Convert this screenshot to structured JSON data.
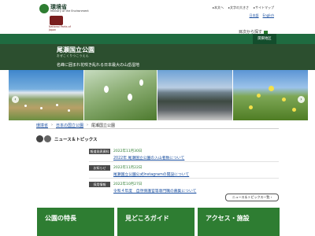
{
  "header": {
    "logo_ministry_ja": "環境省",
    "logo_ministry_en": "Ministry of the Environment",
    "logo_parks_text": "National Parks of Japan",
    "links": [
      "▸本文へ",
      "▸文字の大きさ",
      "▸サイトマップ"
    ],
    "languages": [
      "日本語",
      "English"
    ],
    "toc_button": "目次から探す",
    "band_tab": "関東地区"
  },
  "park": {
    "name": "尾瀬国立公園",
    "kana": "おぜこくりつこうえん",
    "tagline": "名峰に囲まれ花咲き乱れる日本最大の山岳湿地"
  },
  "hero": {
    "prev": "‹",
    "next": "›"
  },
  "breadcrumb": [
    "環境省",
    "日本の国立公園",
    "尾瀬国立公園"
  ],
  "news": {
    "title": "ニュース＆トピックス",
    "items": [
      {
        "tag": "報道発表資料",
        "date": "2022年11月30日",
        "text": "2022年 尾瀬国立公園の入山者数について"
      },
      {
        "tag": "お知らせ",
        "date": "2022年11月22日",
        "text": "尾瀬国立公園公式Instagramの開設について"
      },
      {
        "tag": "採用情報",
        "date": "2022年10月27日",
        "text": "令和４年度　自然保護官等専門職の募集について"
      }
    ],
    "list_button": "ニュース＆トピックス一覧 ›"
  },
  "tiles": [
    "公園の特長",
    "見どころガイド",
    "アクセス・施設"
  ],
  "colors": {
    "green": "#2e7d32",
    "dark_green": "#2c4f2f",
    "link": "#1a4fa0"
  }
}
